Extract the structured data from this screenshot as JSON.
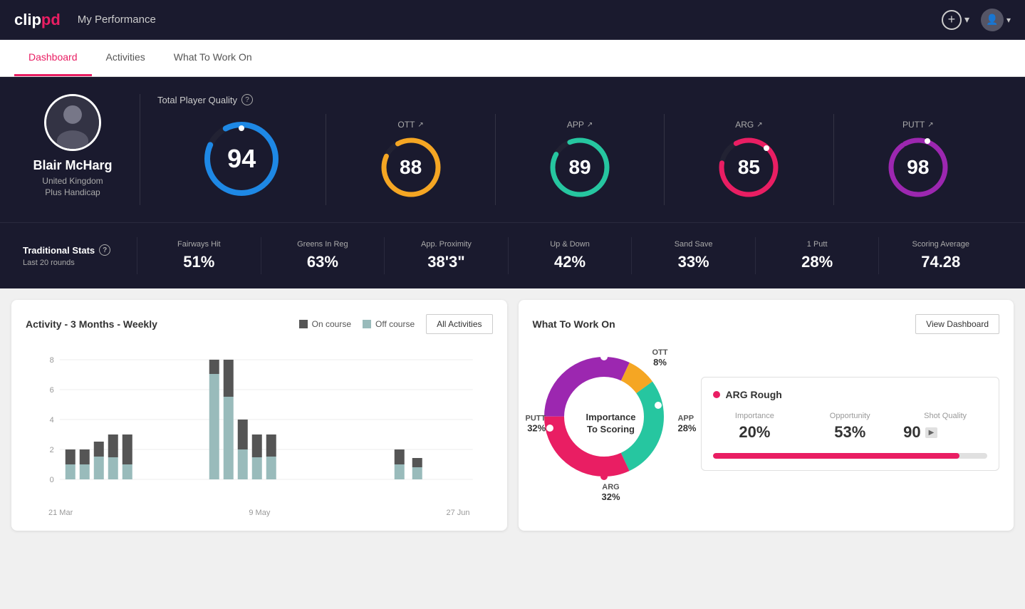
{
  "app": {
    "logo_clip": "clip",
    "logo_pd": "pd",
    "title": "My Performance"
  },
  "nav": {
    "tabs": [
      {
        "id": "dashboard",
        "label": "Dashboard",
        "active": true
      },
      {
        "id": "activities",
        "label": "Activities",
        "active": false
      },
      {
        "id": "what-to-work-on",
        "label": "What To Work On",
        "active": false
      }
    ]
  },
  "player": {
    "name": "Blair McHarg",
    "country": "United Kingdom",
    "handicap": "Plus Handicap",
    "avatar_icon": "👤"
  },
  "scores": {
    "tpq_label": "Total Player Quality",
    "main": {
      "value": "94",
      "color": "#1e88e5"
    },
    "ott": {
      "label": "OTT",
      "value": "88",
      "color": "#f5a623"
    },
    "app": {
      "label": "APP",
      "value": "89",
      "color": "#26c6a0"
    },
    "arg": {
      "label": "ARG",
      "value": "85",
      "color": "#e91e63"
    },
    "putt": {
      "label": "PUTT",
      "value": "98",
      "color": "#9c27b0"
    }
  },
  "traditional_stats": {
    "title": "Traditional Stats",
    "subtitle": "Last 20 rounds",
    "items": [
      {
        "name": "Fairways Hit",
        "value": "51%"
      },
      {
        "name": "Greens In Reg",
        "value": "63%"
      },
      {
        "name": "App. Proximity",
        "value": "38'3\""
      },
      {
        "name": "Up & Down",
        "value": "42%"
      },
      {
        "name": "Sand Save",
        "value": "33%"
      },
      {
        "name": "1 Putt",
        "value": "28%"
      },
      {
        "name": "Scoring Average",
        "value": "74.28"
      }
    ]
  },
  "activity_chart": {
    "title": "Activity - 3 Months - Weekly",
    "legend": {
      "on_course": "On course",
      "off_course": "Off course"
    },
    "all_activities_btn": "All Activities",
    "x_labels": [
      "21 Mar",
      "9 May",
      "27 Jun"
    ],
    "y_labels": [
      "0",
      "2",
      "4",
      "6",
      "8"
    ],
    "bars": [
      {
        "on": 1,
        "off": 1
      },
      {
        "on": 1,
        "off": 1
      },
      {
        "on": 1.5,
        "off": 1
      },
      {
        "on": 2,
        "off": 1.5
      },
      {
        "on": 2,
        "off": 1
      },
      {
        "on": 1,
        "off": 7
      },
      {
        "on": 2.5,
        "off": 5.5
      },
      {
        "on": 2,
        "off": 2
      },
      {
        "on": 2.5,
        "off": 1
      },
      {
        "on": 1.5,
        "off": 1.5
      },
      {
        "on": 1,
        "off": 0.5
      },
      {
        "on": 0.5,
        "off": 0.3
      }
    ]
  },
  "what_to_work_on": {
    "title": "What To Work On",
    "view_dashboard_btn": "View Dashboard",
    "center_text": "Importance\nTo Scoring",
    "segments": [
      {
        "label": "OTT",
        "pct": "8%",
        "color": "#f5a623"
      },
      {
        "label": "APP",
        "pct": "28%",
        "color": "#26c6a0"
      },
      {
        "label": "ARG",
        "pct": "32%",
        "color": "#e91e63"
      },
      {
        "label": "PUTT",
        "pct": "32%",
        "color": "#9c27b0"
      }
    ],
    "highlighted": {
      "title": "ARG Rough",
      "dot_color": "#e91e63",
      "importance_label": "Importance",
      "importance_value": "20%",
      "opportunity_label": "Opportunity",
      "opportunity_value": "53%",
      "quality_label": "Shot Quality",
      "quality_value": "90",
      "quality_fill_pct": 90
    }
  }
}
